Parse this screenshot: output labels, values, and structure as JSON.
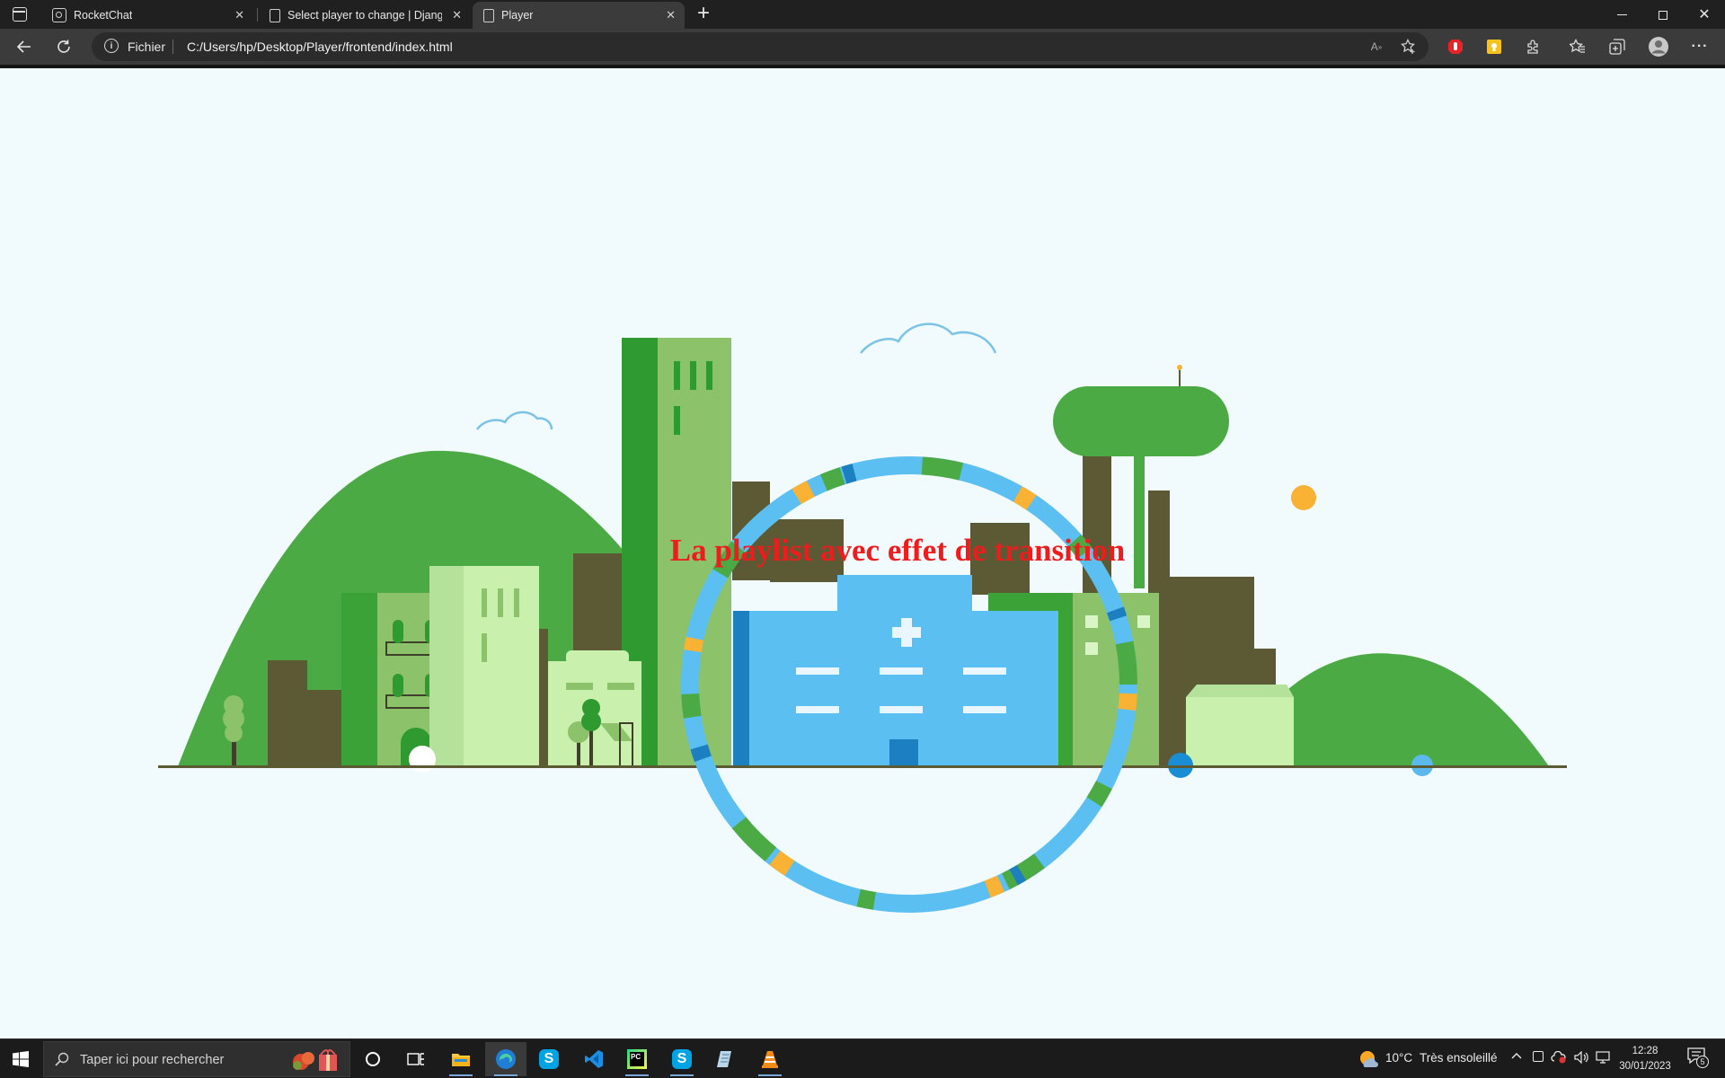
{
  "browser": {
    "tabs": [
      {
        "title": "RocketChat",
        "icon": "rocketchat-icon",
        "active": false
      },
      {
        "title": "Select player to change | Django",
        "icon": "page-icon",
        "active": false
      },
      {
        "title": "Player",
        "icon": "page-icon",
        "active": true
      }
    ],
    "new_tab": "+",
    "address": {
      "scheme_label": "Fichier",
      "url": "C:/Users/hp/Desktop/Player/frontend/index.html"
    }
  },
  "page": {
    "heading": "La playlist avec effet de transition",
    "heading_color": "#ee1c1c",
    "background": "#f1fbfd",
    "animation": "city-skyline-with-ring"
  },
  "taskbar": {
    "search_placeholder": "Taper ici pour rechercher",
    "weather": {
      "temperature": "10°C",
      "condition": "Très ensoleillé"
    },
    "clock": {
      "time": "12:28",
      "date": "30/01/2023"
    },
    "notification_count": "5",
    "pinned_apps": [
      "cortana-icon",
      "task-view-icon",
      "file-explorer-icon",
      "edge-icon",
      "skype-icon",
      "vscode-icon",
      "pycharm-icon",
      "skype-icon",
      "notepad-icon",
      "vlc-icon"
    ]
  }
}
